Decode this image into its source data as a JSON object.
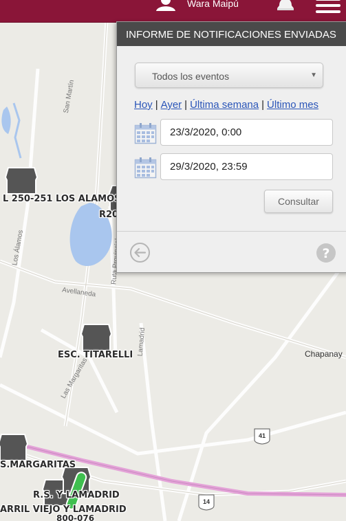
{
  "header": {
    "user_name": "Wara Maipú",
    "brand_color": "#8a1538",
    "icons": [
      "user-icon",
      "bell-icon",
      "hamburger-menu-icon"
    ]
  },
  "panel": {
    "title": "INFORME DE NOTIFICACIONES ENVIADAS",
    "event_filter": {
      "selected": "Todos los eventos"
    },
    "quick_ranges": {
      "today": "Hoy",
      "yesterday": "Ayer",
      "last_week": "Última semana",
      "last_month": "Último mes",
      "separator": "|"
    },
    "date_from": "23/3/2020, 0:00",
    "date_to": "29/3/2020, 23:59",
    "submit_label": "Consultar",
    "icons": [
      "calendar-icon",
      "back-arrow-icon",
      "help-icon"
    ]
  },
  "map": {
    "markers": [
      {
        "label": "L 250-251 LOS ALAMOS"
      },
      {
        "label": "R20"
      },
      {
        "label": "ESC. TITARELLI"
      },
      {
        "label": "S.MARGARITAS"
      },
      {
        "label": "R.S. Y LAMADRID"
      },
      {
        "label": "ARRIL VIEJO Y LAMADRID"
      },
      {
        "label": "800-076"
      }
    ],
    "streets": [
      "San Martín",
      "Los Álamos",
      "Avellaneda",
      "Ruta Provincial",
      "Lamadrid",
      "Las Margaritas"
    ],
    "places": [
      "Chapanay"
    ],
    "route_badges": [
      "41",
      "14"
    ]
  }
}
